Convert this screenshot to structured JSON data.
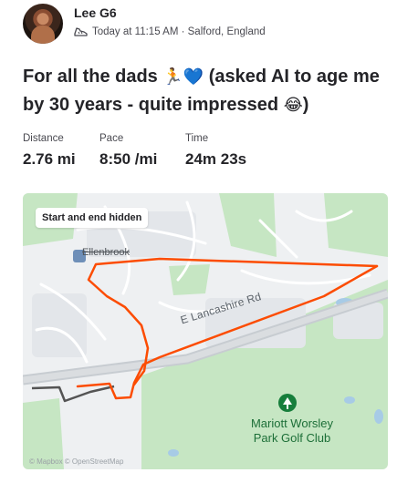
{
  "header": {
    "athlete_name": "Lee G6",
    "activity_meta": "Today at 11:15 AM · Salford, England",
    "activity_icon": "shoe-icon"
  },
  "activity": {
    "title_part1": "For all the dads ",
    "emoji_runner": "🏃",
    "emoji_heart": "💙",
    "title_part2": " (asked AI to age me by 30 years - quite impressed ",
    "emoji_laugh": "😂",
    "title_part3": ")"
  },
  "stats": [
    {
      "label": "Distance",
      "value": "2.76 mi"
    },
    {
      "label": "Pace",
      "value": "8:50 /mi"
    },
    {
      "label": "Time",
      "value": "24m 23s"
    }
  ],
  "map": {
    "badge": "Start and end hidden",
    "road_label": "E Lancashire Rd",
    "place_label": "Ellenbrook",
    "poi_name": "Mariott Worsley Park Golf Club",
    "poi_icon": "tree-icon",
    "watermark": "© Mapbox © OpenStreetMap",
    "route_color": "#fc4c02",
    "park_color": "#c6e6c3"
  }
}
